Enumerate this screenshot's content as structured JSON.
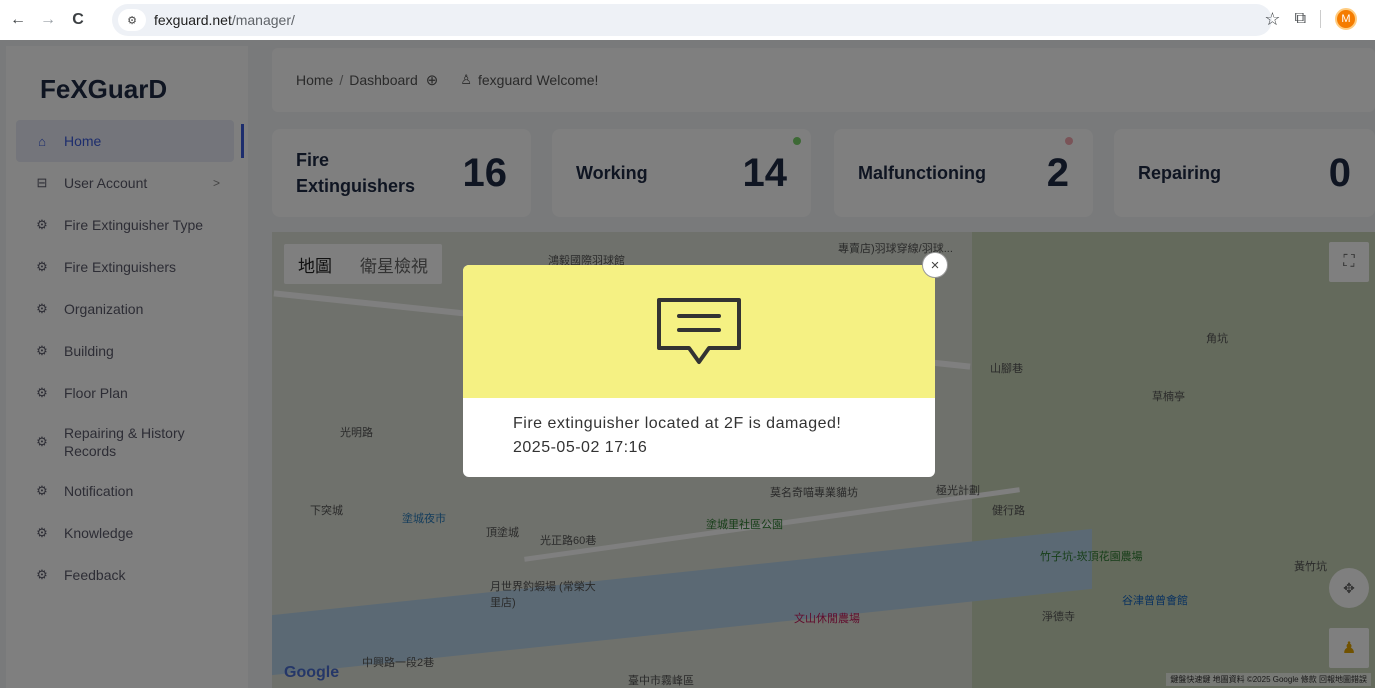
{
  "browser": {
    "back_icon": "←",
    "forward_icon": "→",
    "reload_icon": "C",
    "url_host": "fexguard.net",
    "url_path": "/manager/",
    "star_icon": "☆",
    "extension_icon": "⧉",
    "profile_initial": "M"
  },
  "sidebar": {
    "logo": "FeXGuarD",
    "items": [
      {
        "label": "Home",
        "icon": "home-icon",
        "active": true
      },
      {
        "label": "User Account",
        "icon": "table-icon",
        "arrow": ">"
      },
      {
        "label": "Fire Extinguisher Type",
        "icon": "gear-icon"
      },
      {
        "label": "Fire Extinguishers",
        "icon": "gear-icon"
      },
      {
        "label": "Organization",
        "icon": "gear-icon"
      },
      {
        "label": "Building",
        "icon": "gear-icon"
      },
      {
        "label": "Floor Plan",
        "icon": "gear-icon"
      },
      {
        "label": "Repairing & History Records",
        "icon": "gear-icon"
      },
      {
        "label": "Notification",
        "icon": "gear-icon"
      },
      {
        "label": "Knowledge",
        "icon": "gear-icon"
      },
      {
        "label": "Feedback",
        "icon": "gear-icon"
      }
    ]
  },
  "header": {
    "breadcrumb_home": "Home",
    "breadcrumb_sep": "/",
    "breadcrumb_current": "Dashboard",
    "username": "fexguard",
    "welcome": "Welcome!"
  },
  "stats": [
    {
      "label": "Fire Extinguishers",
      "value": "16",
      "dot_color": null
    },
    {
      "label": "Working",
      "value": "14",
      "dot_color": "#7bd36a"
    },
    {
      "label": "Malfunctioning",
      "value": "2",
      "dot_color": "#f4a9b1"
    },
    {
      "label": "Repairing",
      "value": "0",
      "dot_color": null
    }
  ],
  "map": {
    "map_tab": "地圖",
    "satellite_tab": "衛星檢視",
    "google": "Google",
    "attribution": "鍵盤快速鍵  地圖資料 ©2025 Google  條款  回報地圖錯誤",
    "labels": [
      "鴻毅國際羽球館",
      "專賣店)羽球穿線/羽球...",
      "山腳巷",
      "角坑",
      "草楠亭",
      "莫名奇喵專業貓坊",
      "極光計劃",
      "塗城夜市",
      "頂塗城",
      "塗城里社區公園",
      "竹子坑-崁頂花園農場",
      "月世界釣蝦場 (常榮大里店)",
      "文山休閒農場",
      "淨德寺",
      "谷津曾曾會館",
      "臺中市霧峰區",
      "光明路",
      "下突城",
      "中興路一段2巷",
      "黃竹坑",
      "光正路60巷",
      "健行路"
    ]
  },
  "modal": {
    "message": "Fire extinguisher located at 2F is damaged!",
    "timestamp": "2025-05-02 17:16",
    "close_icon": "×"
  },
  "colors": {
    "modal_header": "#f5f183",
    "accent": "#3b5bdb"
  }
}
